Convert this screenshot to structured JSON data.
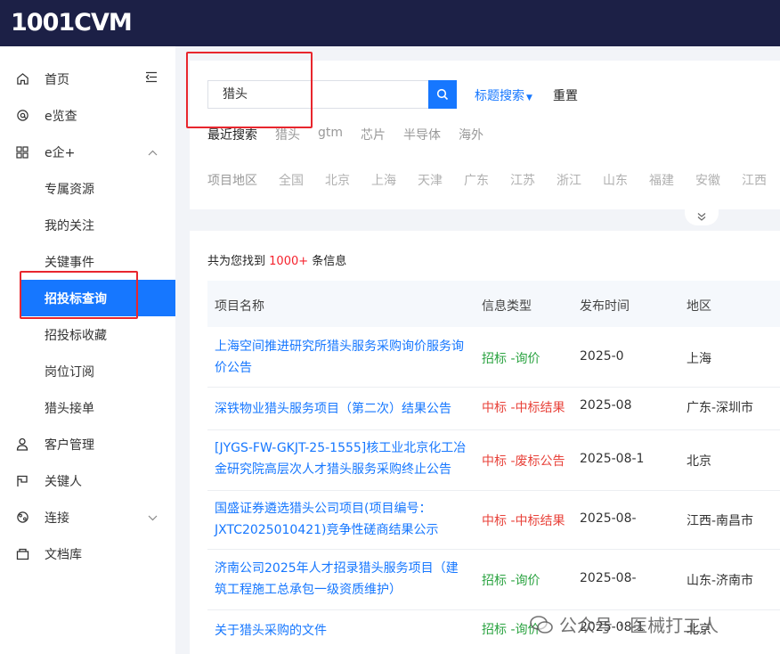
{
  "brand": {
    "logo_text": "1001CVM"
  },
  "sidebar": {
    "items": [
      {
        "label": "首页",
        "icon": "home-icon",
        "name": "sidebar-item-home"
      },
      {
        "label": "e览查",
        "icon": "at-icon",
        "name": "sidebar-item-elancha"
      },
      {
        "label": "e企+",
        "icon": "grid-icon",
        "name": "sidebar-item-eqi"
      },
      {
        "label": "专属资源",
        "name": "sidebar-item-exclusive"
      },
      {
        "label": "我的关注",
        "name": "sidebar-item-follow"
      },
      {
        "label": "关键事件",
        "name": "sidebar-item-events"
      },
      {
        "label": "招投标查询",
        "name": "sidebar-item-bid-search"
      },
      {
        "label": "招投标收藏",
        "name": "sidebar-item-bid-fav"
      },
      {
        "label": "岗位订阅",
        "name": "sidebar-item-jobs"
      },
      {
        "label": "猎头接单",
        "name": "sidebar-item-headhunt"
      },
      {
        "label": "客户管理",
        "icon": "user-icon",
        "name": "sidebar-item-customers"
      },
      {
        "label": "关键人",
        "icon": "flag-icon",
        "name": "sidebar-item-keyperson"
      },
      {
        "label": "连接",
        "icon": "link-icon",
        "name": "sidebar-item-connect"
      },
      {
        "label": "文档库",
        "icon": "doc-icon",
        "name": "sidebar-item-docs"
      }
    ]
  },
  "search": {
    "value": "猎头",
    "mode_label": "标题搜索",
    "reset_label": "重置",
    "recent_label": "最近搜索",
    "recent_tags": [
      "猎头",
      "gtm",
      "芯片",
      "半导体",
      "海外"
    ],
    "region_label": "项目地区",
    "regions": [
      "全国",
      "北京",
      "上海",
      "天津",
      "广东",
      "江苏",
      "浙江",
      "山东",
      "福建",
      "安徽",
      "江西"
    ]
  },
  "results": {
    "count_prefix": "共为您找到",
    "count": "1000+",
    "count_suffix": "条信息",
    "columns": [
      "项目名称",
      "信息类型",
      "发布时间",
      "地区"
    ],
    "rows": [
      {
        "name": "上海空间推进研究所猎头服务采购询价服务询价公告",
        "type": "招标 -询价",
        "date": "2025-0",
        "region": "上海"
      },
      {
        "name": "深铁物业猎头服务项目（第二次）结果公告",
        "type": "中标 -中标结果",
        "date": "2025-08",
        "region": "广东-深圳市"
      },
      {
        "name": "[JYGS-FW-GKJT-25-1555]核工业北京化工冶金研究院高层次人才猎头服务采购终止公告",
        "type": "中标 -废标公告",
        "date": "2025-08-1",
        "region": "北京"
      },
      {
        "name": "国盛证券遴选猎头公司项目(项目编号：JXTC2025010421)竞争性磋商结果公示",
        "type": "中标 -中标结果",
        "date": "2025-08-",
        "region": "江西-南昌市"
      },
      {
        "name": "济南公司2025年人才招录猎头服务项目（建筑工程施工总承包一级资质维护）",
        "type": "招标 -询价",
        "date": "2025-08-",
        "region": "山东-济南市"
      },
      {
        "name": "关于猎头采购的文件",
        "type": "招标 -询价",
        "date": "2025-08-1",
        "region": "北京"
      }
    ]
  },
  "watermark": {
    "text": "公众号 · 医械打工人"
  },
  "colors": {
    "accent": "#1677ff",
    "topbar": "#1c2046",
    "green": "#2ba341",
    "red": "#e8423a",
    "highlight": "#e8262d"
  }
}
